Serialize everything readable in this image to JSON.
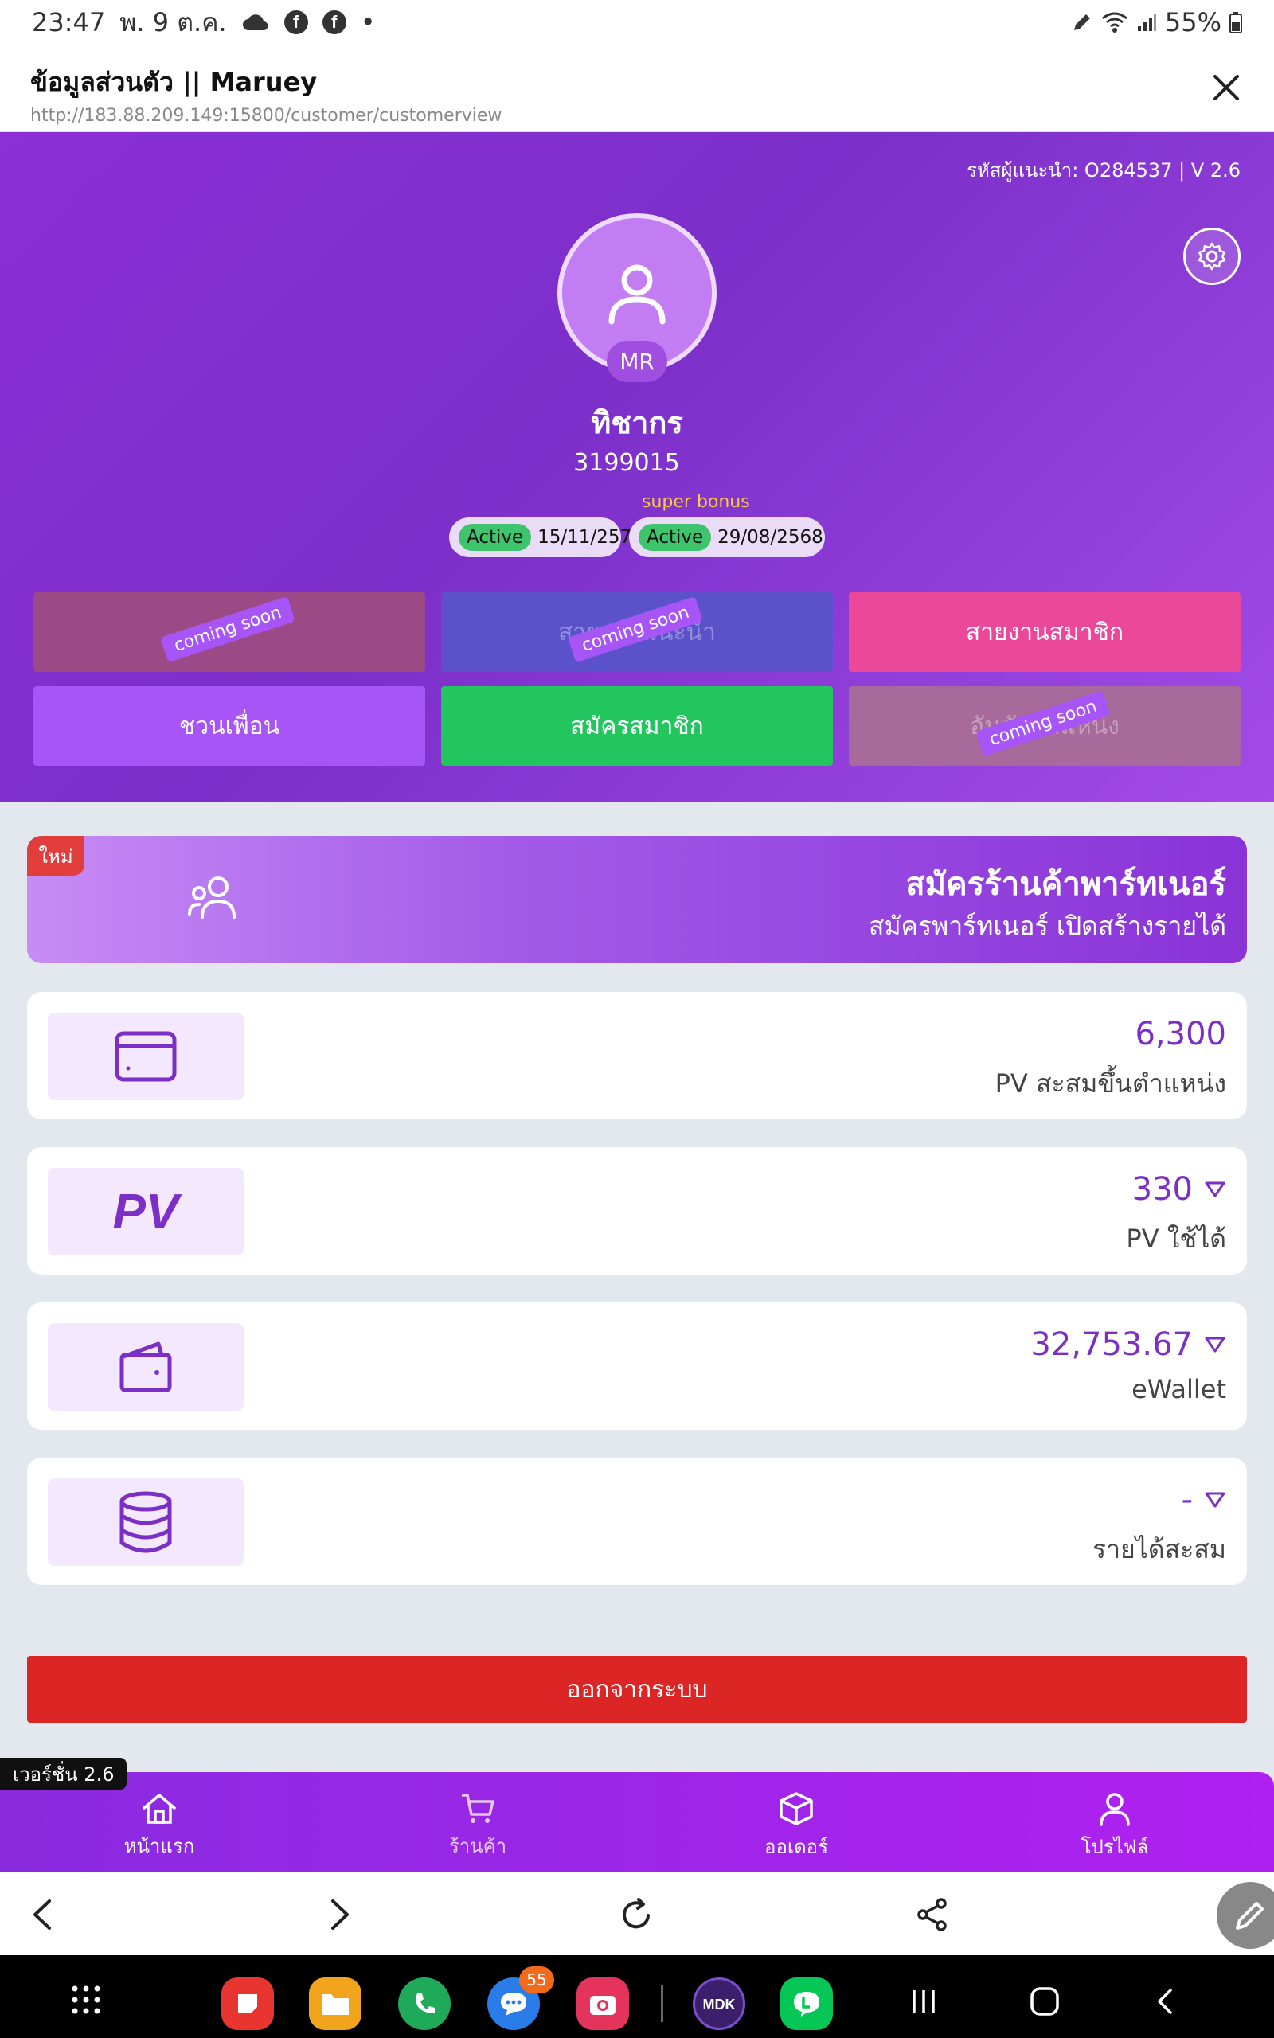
{
  "status_bar": {
    "time": "23:47",
    "date": "พ. 9 ต.ค.",
    "battery": "55%"
  },
  "browser": {
    "page_title": "ข้อมูลส่วนตัว || Maruey",
    "url": "http://183.88.209.149:15800/customer/customerview"
  },
  "profile": {
    "referral": "รหัสผู้แนะนำ: O284537 | V 2.6",
    "initials": "MR",
    "name": "ทิชากร",
    "member_id": "3199015",
    "super_bonus_label": "super bonus",
    "status_1": {
      "label": "Active",
      "date": "15/11/2571"
    },
    "status_2": {
      "label": "Active",
      "date": "29/08/2568"
    }
  },
  "menu": {
    "btn1": {
      "label": "...",
      "coming": "coming soon"
    },
    "btn2": {
      "label": "สายงานแนะนำ",
      "coming": "coming soon"
    },
    "btn3": {
      "label": "สายงานสมาชิก"
    },
    "btn4": {
      "label": "ชวนเพื่อน"
    },
    "btn5": {
      "label": "สมัครสมาชิก"
    },
    "btn6": {
      "label": "อันดับตำแหน่ง",
      "coming": "coming soon"
    }
  },
  "partner": {
    "badge": "ใหม่",
    "title": "สมัครร้านค้าพาร์ทเนอร์",
    "subtitle": "สมัครพาร์ทเนอร์ เปิดสร้างรายได้"
  },
  "stats": [
    {
      "value": "6,300",
      "label": "PV สะสมขึ้นตำแหน่ง",
      "icon": "card-icon"
    },
    {
      "value": "330",
      "label": "PV ใช้ได้",
      "icon": "pv-icon",
      "icon_text": "PV"
    },
    {
      "value": "32,753.67",
      "label": "eWallet",
      "icon": "wallet-icon"
    },
    {
      "value": "-",
      "label": "รายได้สะสม",
      "icon": "database-icon"
    }
  ],
  "logout_label": "ออกจากระบบ",
  "version_tag": "เวอร์ชั่น 2.6",
  "bottom_nav": [
    {
      "label": "หน้าแรก",
      "icon": "home-icon"
    },
    {
      "label": "ร้านค้า",
      "icon": "cart-icon"
    },
    {
      "label": "ออเดอร์",
      "icon": "box-icon"
    },
    {
      "label": "โปรไฟล์",
      "icon": "user-icon"
    }
  ],
  "app_badge_count": "55",
  "colors": {
    "primary": "#7c2fc9",
    "pink": "#ec4899",
    "green": "#22c55e",
    "red": "#dc2626"
  }
}
